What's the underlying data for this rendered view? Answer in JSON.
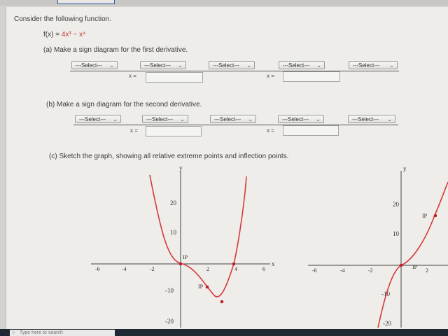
{
  "question": {
    "intro": "Consider the following function.",
    "function_prefix": "f(x) = ",
    "function_expr": "4x³ − x⁴",
    "part_a": "(a) Make a sign diagram for the first derivative.",
    "part_b": "(b) Make a sign diagram for the second derivative.",
    "part_c": "(c) Sketch the graph, showing all relative extreme points and inflection points."
  },
  "select_placeholder": "---Select---",
  "x_label": "x =",
  "graph1": {
    "y_axis_label": "y",
    "x_axis_label": "x",
    "y_ticks": [
      "20",
      "10",
      "-10",
      "-20"
    ],
    "x_ticks": [
      "-6",
      "-4",
      "-2",
      "2",
      "4",
      "6"
    ],
    "annotations": [
      "IP",
      "IP"
    ]
  },
  "graph2": {
    "y_axis_label": "y",
    "y_ticks": [
      "20",
      "10",
      "-10",
      "-20"
    ],
    "x_ticks": [
      "-6",
      "-4",
      "-2",
      "2"
    ],
    "annotations": [
      "IP",
      "IP"
    ]
  },
  "taskbar": {
    "search_placeholder": "Type here to search"
  },
  "colors": {
    "curve": "#d43a3a",
    "point": "#c0202a"
  }
}
